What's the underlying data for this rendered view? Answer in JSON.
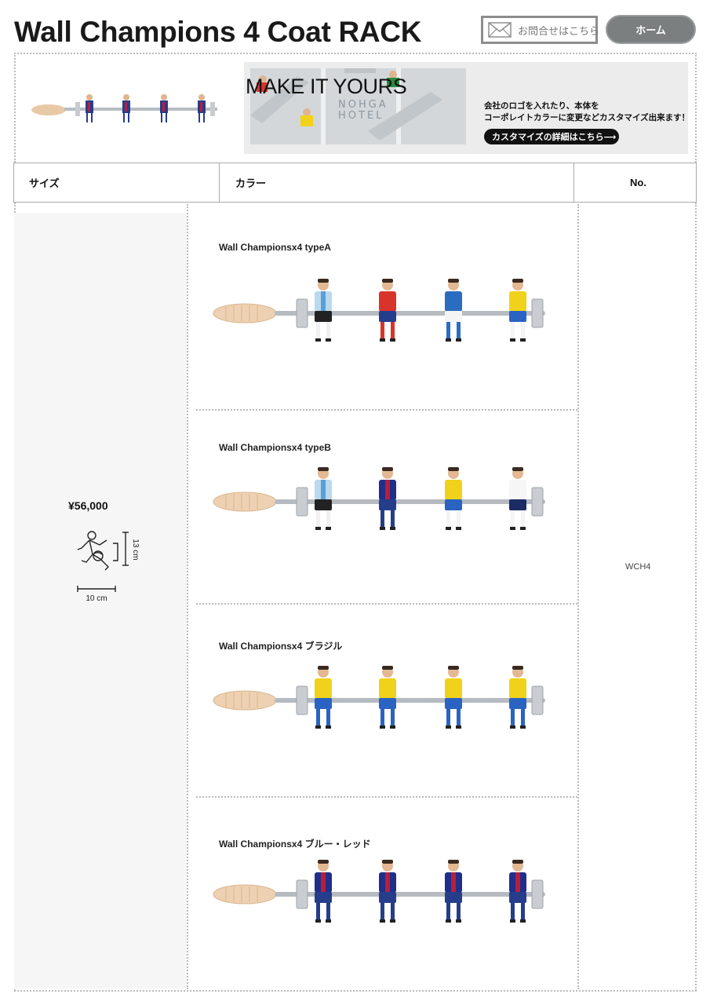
{
  "header": {
    "title": "Wall Champions 4 Coat RACK",
    "contact_label": "お問合せはこちら",
    "home_label": "ホーム"
  },
  "banner": {
    "hotel_text_line1": "NOHGA",
    "hotel_text_line2": "HOTEL",
    "headline": "MAKE IT YOURS",
    "desc_line1": "会社のロゴを入れたり、本体を",
    "desc_line2": "コーポレイトカラーに変更などカスタマイズ出来ます！",
    "cta_label": "カスタマイズの詳細はこちら⟶"
  },
  "table": {
    "headers": [
      "サイズ",
      "カラー",
      "No."
    ],
    "price": "¥56,000",
    "height_label": "13 cm",
    "width_label": "10 cm",
    "number": "WCH4",
    "products": [
      {
        "name": "Wall Championsx4 typeA",
        "players": [
          {
            "shirt": "#b9d9ef",
            "stripe": "#5aa0d6",
            "shorts": "#222222",
            "socks": "#f0f0f0"
          },
          {
            "shirt": "#d9342b",
            "stripe": "#d9342b",
            "shorts": "#263d8c",
            "socks": "#d9342b"
          },
          {
            "shirt": "#2a6cc0",
            "stripe": "#2a6cc0",
            "shorts": "#f4f4f4",
            "socks": "#2a6cc0"
          },
          {
            "shirt": "#f0d21a",
            "stripe": "#f0d21a",
            "shorts": "#2a63c2",
            "socks": "#f4f4f4"
          }
        ]
      },
      {
        "name": "Wall Championsx4 typeB",
        "players": [
          {
            "shirt": "#b9d9ef",
            "stripe": "#5aa0d6",
            "shorts": "#222222",
            "socks": "#f0f0f0"
          },
          {
            "shirt": "#1f2f8a",
            "stripe": "#b81e3c",
            "shorts": "#263d8c",
            "socks": "#263d8c"
          },
          {
            "shirt": "#f0d21a",
            "stripe": "#f0d21a",
            "shorts": "#2a63c2",
            "socks": "#f4f4f4"
          },
          {
            "shirt": "#f6f6f6",
            "stripe": "#f6f6f6",
            "shorts": "#1c2a66",
            "socks": "#f4f4f4"
          }
        ]
      },
      {
        "name": "Wall Championsx4 ブラジル",
        "players": [
          {
            "shirt": "#f0d21a",
            "stripe": "#f0d21a",
            "shorts": "#2a63c2",
            "socks": "#2a63c2"
          },
          {
            "shirt": "#f0d21a",
            "stripe": "#f0d21a",
            "shorts": "#2a63c2",
            "socks": "#2a63c2"
          },
          {
            "shirt": "#f0d21a",
            "stripe": "#f0d21a",
            "shorts": "#2a63c2",
            "socks": "#2a63c2"
          },
          {
            "shirt": "#f0d21a",
            "stripe": "#f0d21a",
            "shorts": "#2a63c2",
            "socks": "#2a63c2"
          }
        ]
      },
      {
        "name": "Wall Championsx4 ブルー・レッド",
        "players": [
          {
            "shirt": "#1f2f8a",
            "stripe": "#b81e3c",
            "shorts": "#263d8c",
            "socks": "#263d8c"
          },
          {
            "shirt": "#1f2f8a",
            "stripe": "#b81e3c",
            "shorts": "#263d8c",
            "socks": "#263d8c"
          },
          {
            "shirt": "#1f2f8a",
            "stripe": "#b81e3c",
            "shorts": "#263d8c",
            "socks": "#263d8c"
          },
          {
            "shirt": "#1f2f8a",
            "stripe": "#b81e3c",
            "shorts": "#263d8c",
            "socks": "#263d8c"
          }
        ]
      }
    ]
  }
}
